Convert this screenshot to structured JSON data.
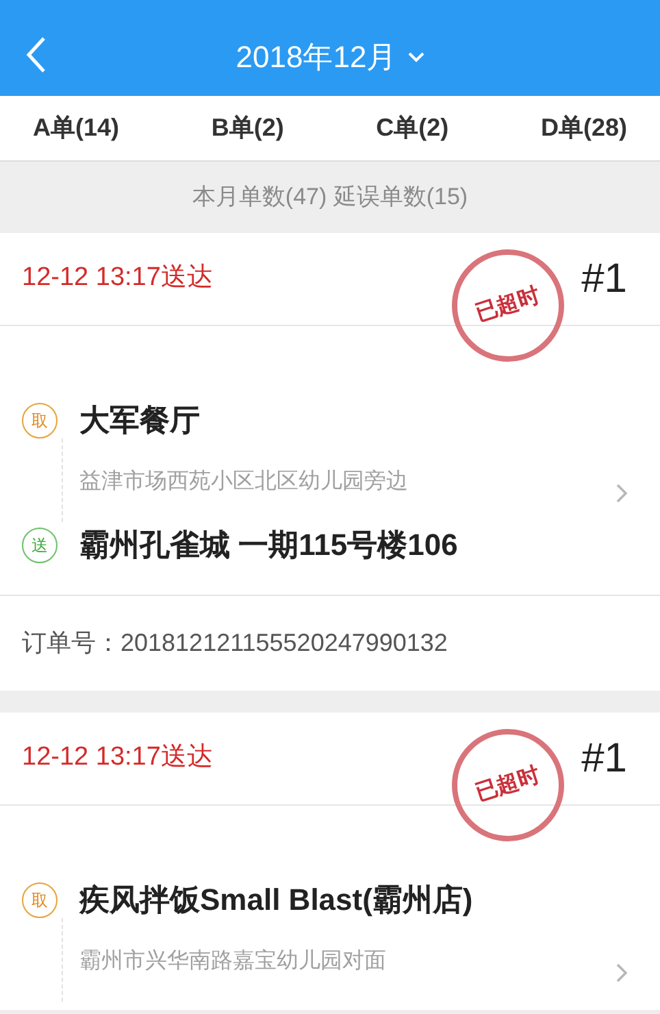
{
  "header": {
    "title": "2018年12月"
  },
  "tabs": [
    {
      "label": "A单(14)"
    },
    {
      "label": "B单(2)"
    },
    {
      "label": "C单(2)"
    },
    {
      "label": "D单(28)"
    }
  ],
  "summary": "本月单数(47) 延误单数(15)",
  "orders": [
    {
      "deliver_by": "12-12 13:17送达",
      "stamp": "已超时",
      "number": "#1",
      "stops": [
        {
          "kind": "pickup",
          "badge": "取",
          "name": "大军餐厅",
          "address": "益津市场西苑小区北区幼儿园旁边"
        },
        {
          "kind": "delivery",
          "badge": "送",
          "name": "霸州孔雀城 一期115号楼106"
        }
      ],
      "order_no": "订单号：201812121155520247990132"
    },
    {
      "deliver_by": "12-12 13:17送达",
      "stamp": "已超时",
      "number": "#1",
      "stops": [
        {
          "kind": "pickup",
          "badge": "取",
          "name": "疾风拌饭Small Blast(霸州店)",
          "address": "霸州市兴华南路嘉宝幼儿园对面"
        }
      ]
    }
  ]
}
